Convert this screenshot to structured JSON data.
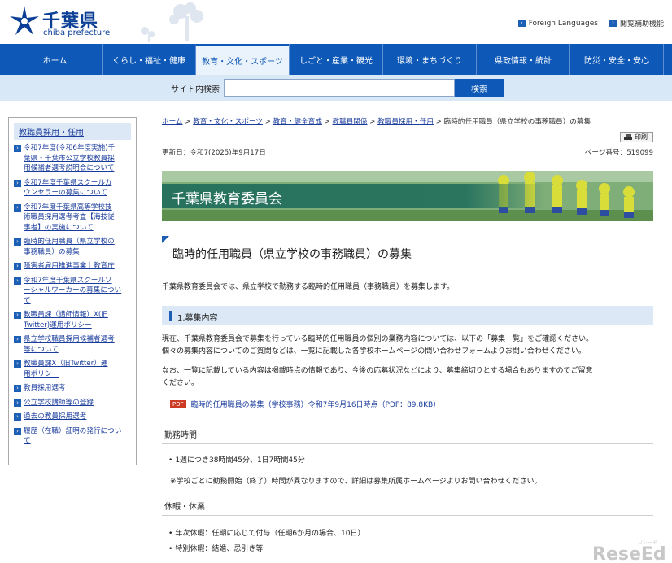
{
  "header": {
    "logo_name": "千葉県",
    "logo_sub": "chiba prefecture",
    "links": [
      {
        "label": "Foreign Languages"
      },
      {
        "label": "閲覧補助機能"
      }
    ]
  },
  "gnav": [
    {
      "label": "ホーム"
    },
    {
      "label": "くらし・福祉・健康"
    },
    {
      "label": "教育・文化・スポーツ"
    },
    {
      "label": "しごと・産業・観光"
    },
    {
      "label": "環境・まちづくり"
    },
    {
      "label": "県政情報・統計"
    },
    {
      "label": "防災・安全・安心"
    }
  ],
  "search": {
    "label": "サイト内検索",
    "value": "",
    "button": "検索"
  },
  "sidebar": {
    "title": "教職員採用・任用",
    "items": [
      {
        "lines": [
          "令和7年度(令和6年度実施)千",
          "葉県・千葉市公立学校教員採",
          "用候補者選考説明会について"
        ]
      },
      {
        "lines": [
          "令和7年度千葉県スクールカ",
          "ウンセラーの募集について"
        ]
      },
      {
        "lines": [
          "令和7年度千葉県高等学校技",
          "術職員採用選考考査【海技従",
          "事者】の実施について"
        ]
      },
      {
        "lines": [
          "臨時的任用職員（県立学校の",
          "事務職員）の募集"
        ]
      },
      {
        "lines": [
          "障害者雇用推進事業｜教育庁"
        ]
      },
      {
        "lines": [
          "令和7年度千葉県スクールソ",
          "ーシャルワーカーの募集につい",
          "て"
        ]
      },
      {
        "lines": [
          "教職員課（講師情報）X(旧",
          "Twitter)運用ポリシー"
        ]
      },
      {
        "lines": [
          "県立学校職員採用候補者選考",
          "等について"
        ]
      },
      {
        "lines": [
          "教職員課X（旧Twitter）運",
          "用ポリシー"
        ]
      },
      {
        "lines": [
          "教員採用選考"
        ]
      },
      {
        "lines": [
          "公立学校講師等の登録"
        ]
      },
      {
        "lines": [
          "過去の教員採用選考"
        ]
      },
      {
        "lines": [
          "履歴（在職）証明の発行につい",
          "て"
        ]
      }
    ]
  },
  "breadcrumb": {
    "items": [
      {
        "label": "ホーム"
      },
      {
        "label": "教育・文化・スポーツ"
      },
      {
        "label": "教育・健全育成"
      },
      {
        "label": "教職員関係"
      },
      {
        "label": "教職員採用・任用"
      }
    ],
    "sep": " > ",
    "current": "臨時的任用職員（県立学校の事務職員）の募集"
  },
  "print_label": "印刷",
  "updated": "更新日：令和7(2025)年9月17日",
  "page_number": "ページ番号：519099",
  "banner_title": "千葉県教育委員会",
  "page_title": "臨時的任用職員（県立学校の事務職員）の募集",
  "intro": "千葉県教育委員会では、県立学校で勤務する臨時的任用職員（事務職員）を募集します。",
  "section1": {
    "title": "1.募集内容",
    "p1": [
      "現在、千葉県教育委員会で募集を行っている臨時的任用職員の個別の業務内容については、以下の「募集一覧」をご確認ください。",
      "個々の募集内容についてのご質問などは、一覧に記載した各学校ホームページの問い合わせフォームよりお問い合わせください。"
    ],
    "p2": [
      "なお、一覧に記載している内容は掲載時点の情報であり、今後の応募状況などにより、募集締切りとする場合もありますのでご留意",
      "ください。"
    ],
    "pdf_badge": "PDF",
    "pdf_link": "臨時的任用職員の募集（学校事務）令和7年9月16日時点（PDF：89.8KB）",
    "work_hours_title": "勤務時間",
    "work_hours": "1週につき38時間45分、1日7時間45分",
    "work_hours_note": "※学校ごとに勤務開始（終了）時間が異なりますので、詳細は募集所属ホームページよりお問い合わせください。",
    "holidays_title": "休暇・休業",
    "annual_leave": "年次休暇：任期に応じて付与（任期6か月の場合、10日）",
    "special_leave": "特別休暇：結婚、忌引き等"
  },
  "watermark": "ReseEd",
  "watermark_sub": "リシード",
  "colors": {
    "nav_blue": "#0e58b7",
    "search_band": "#d9e8f7",
    "banner_green": "#24705c",
    "pdf_red": "#cc3a23"
  }
}
